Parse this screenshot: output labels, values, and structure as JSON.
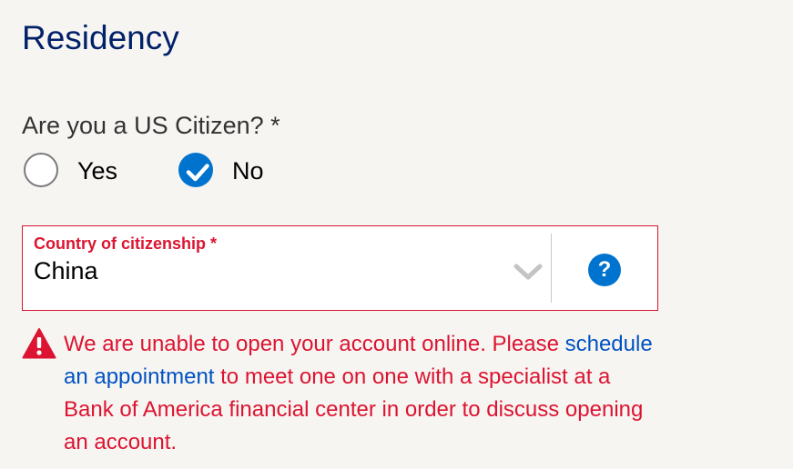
{
  "section": {
    "title": "Residency"
  },
  "citizenship_question": {
    "label": "Are you a US Citizen? *",
    "options": [
      {
        "label": "Yes",
        "checked": false
      },
      {
        "label": "No",
        "checked": true
      }
    ]
  },
  "country_field": {
    "label": "Country of citizenship *",
    "value": "China",
    "chevron_icon": "chevron-down-icon",
    "help_icon_label": "?"
  },
  "error_message": {
    "icon": "warning-triangle-icon",
    "text_before": "We are unable to open your account online. Please ",
    "link_text": "schedule an appointment",
    "text_after": " to meet one on one with a specialist at a Bank of America financial center in order to discuss opening an account."
  },
  "colors": {
    "brand_navy": "#012169",
    "error_red": "#dc1431",
    "accent_blue": "#0073cf",
    "link_blue": "#0052c2",
    "background": "#f7f5f2"
  }
}
